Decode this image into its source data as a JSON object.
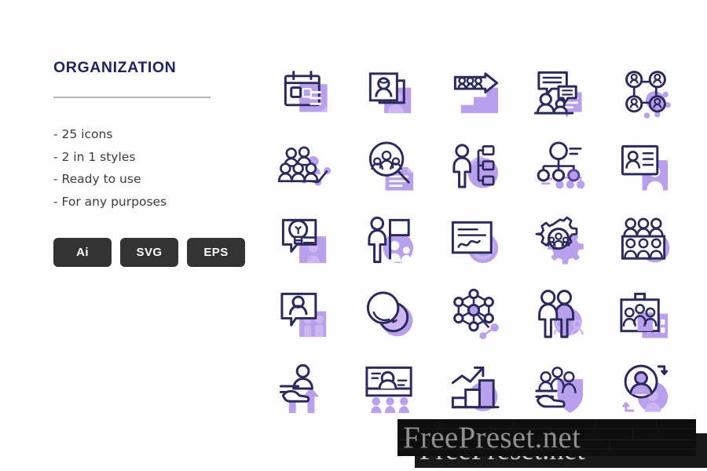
{
  "page": {
    "background": "#fefefe",
    "title_color": "#1e2460",
    "accent_purple": "#b9a0ec",
    "outline_navy": "#2b2a5e",
    "badge_bg": "#333333",
    "divider_color": "#b4b4b4"
  },
  "left_panel": {
    "title": "ORGANIZATION",
    "features": [
      "- 25 icons",
      "- 2 in 1 styles",
      "- Ready to use",
      "- For any purposes"
    ],
    "badges": [
      {
        "label": "Ai",
        "name": "badge-ai"
      },
      {
        "label": "SVG",
        "name": "badge-svg"
      },
      {
        "label": "EPS",
        "name": "badge-eps"
      }
    ]
  },
  "icon_grid": {
    "columns": 5,
    "rows": 5,
    "count": 25,
    "icons": [
      {
        "name": "calendar-schedule-icon",
        "label": "Calendar schedule"
      },
      {
        "name": "employee-profile-card-icon",
        "label": "Employee profile card"
      },
      {
        "name": "team-growth-arrow-icon",
        "label": "Team growth arrow"
      },
      {
        "name": "meeting-discussion-icon",
        "label": "Meeting discussion"
      },
      {
        "name": "team-network-grid-icon",
        "label": "Team network grid"
      },
      {
        "name": "workforce-group-icon",
        "label": "Workforce group"
      },
      {
        "name": "candidate-search-icon",
        "label": "Candidate search"
      },
      {
        "name": "employee-workflow-icon",
        "label": "Employee workflow"
      },
      {
        "name": "org-hierarchy-icon",
        "label": "Organization hierarchy"
      },
      {
        "name": "id-badge-icon",
        "label": "ID badge"
      },
      {
        "name": "idea-chat-bulb-icon",
        "label": "Idea chat bulb"
      },
      {
        "name": "leader-flag-icon",
        "label": "Leader with flag"
      },
      {
        "name": "performance-report-icon",
        "label": "Performance report"
      },
      {
        "name": "team-settings-gear-icon",
        "label": "Team settings gear"
      },
      {
        "name": "audience-seats-icon",
        "label": "Audience seats"
      },
      {
        "name": "video-conference-icon",
        "label": "Video conference"
      },
      {
        "name": "payroll-coins-icon",
        "label": "Payroll coins"
      },
      {
        "name": "network-nodes-icon",
        "label": "Network nodes"
      },
      {
        "name": "partners-pair-icon",
        "label": "Business partners"
      },
      {
        "name": "company-office-icon",
        "label": "Company office"
      },
      {
        "name": "employee-support-icon",
        "label": "Employee support"
      },
      {
        "name": "online-training-icon",
        "label": "Online training"
      },
      {
        "name": "growth-chart-icon",
        "label": "Growth chart"
      },
      {
        "name": "team-protection-icon",
        "label": "Team protection"
      },
      {
        "name": "employee-turnover-icon",
        "label": "Employee turnover"
      }
    ]
  },
  "watermarks": {
    "primary": "FreePreset.net",
    "secondary": "FreePreset.net"
  }
}
